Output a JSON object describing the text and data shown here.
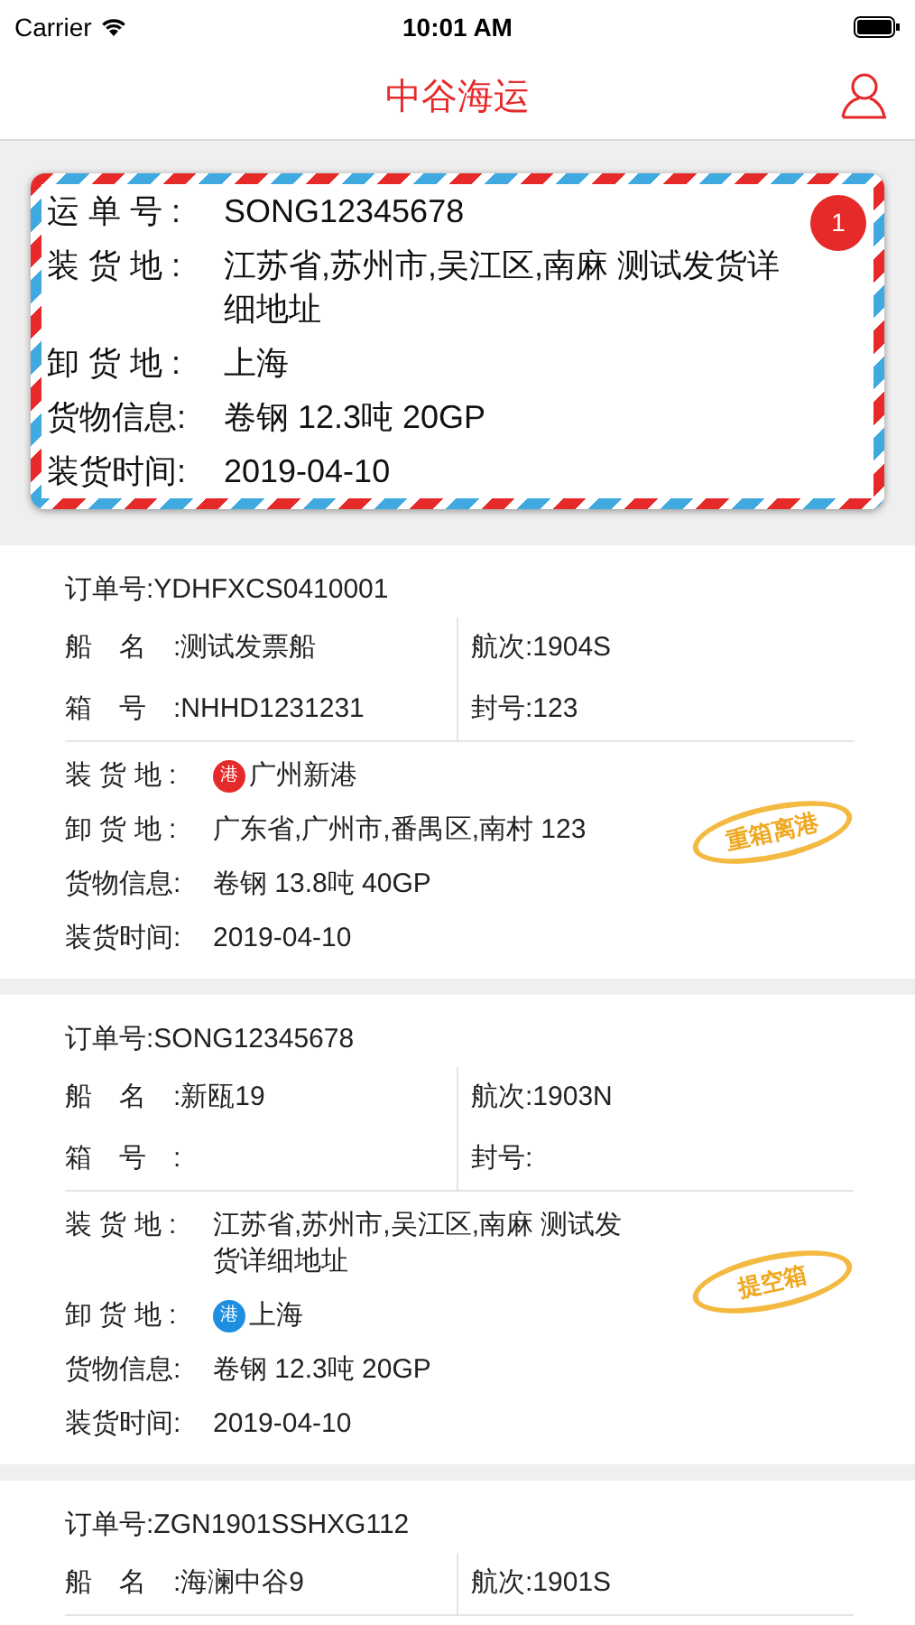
{
  "status_bar": {
    "carrier": "Carrier",
    "time": "10:01 AM"
  },
  "nav": {
    "title": "中谷海运"
  },
  "featured": {
    "badge": "1",
    "rows": [
      {
        "label": "运 单 号 :",
        "value": "SONG12345678"
      },
      {
        "label": "装 货 地 :",
        "value": "江苏省,苏州市,吴江区,南麻 测试发货详细地址"
      },
      {
        "label": "卸 货 地 :",
        "value": "上海"
      },
      {
        "label": "货物信息:",
        "value": "卷钢 12.3吨 20GP"
      },
      {
        "label": "装货时间:",
        "value": "2019-04-10"
      }
    ]
  },
  "orders": [
    {
      "order": {
        "label": "订单号:",
        "value": "YDHFXCS0410001"
      },
      "grid": [
        {
          "label": "船　名　:",
          "value": "测试发票船"
        },
        {
          "label": "航次:",
          "value": "1904S"
        },
        {
          "label": "箱　号　:",
          "value": "NHHD1231231"
        },
        {
          "label": "封号:",
          "value": "123"
        }
      ],
      "details": [
        {
          "label": "装 货 地 :",
          "value": "广州新港",
          "port": {
            "text": "港",
            "color": "#e62a2a"
          }
        },
        {
          "label": "卸 货 地 :",
          "value": "广东省,广州市,番禺区,南村 123"
        },
        {
          "label": "货物信息:",
          "value": "卷钢 13.8吨 40GP"
        },
        {
          "label": "装货时间:",
          "value": "2019-04-10"
        }
      ],
      "stamp": "重箱离港"
    },
    {
      "order": {
        "label": "订单号:",
        "value": "SONG12345678"
      },
      "grid": [
        {
          "label": "船　名　:",
          "value": "新瓯19"
        },
        {
          "label": "航次:",
          "value": "1903N"
        },
        {
          "label": "箱　号　:"
        },
        {
          "label": "封号:"
        }
      ],
      "details": [
        {
          "label": "装 货 地 :",
          "value": "江苏省,苏州市,吴江区,南麻 测试发货详细地址"
        },
        {
          "label": "卸 货 地 :",
          "value": "上海",
          "port": {
            "text": "港",
            "color": "#1e8fe0"
          }
        },
        {
          "label": "货物信息:",
          "value": "卷钢 12.3吨 20GP"
        },
        {
          "label": "装货时间:",
          "value": "2019-04-10"
        }
      ],
      "stamp": "提空箱"
    },
    {
      "order": {
        "label": "订单号:",
        "value": "ZGN1901SSHXG112"
      },
      "grid": [
        {
          "label": "船　名　:",
          "value": "海澜中谷9"
        },
        {
          "label": "航次:",
          "value": "1901S"
        }
      ]
    }
  ]
}
